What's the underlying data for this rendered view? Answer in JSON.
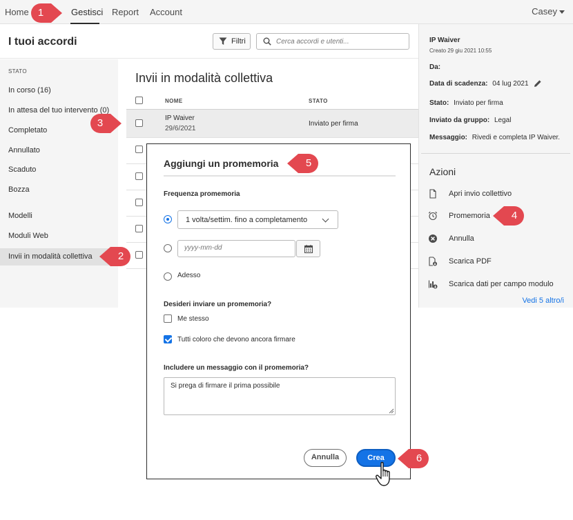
{
  "nav": {
    "tabs": [
      "Home",
      "Gestisci",
      "Report",
      "Account"
    ],
    "active_tab": "Gestisci",
    "user": "Casey"
  },
  "header": {
    "title": "I tuoi accordi",
    "filter_label": "Filtri",
    "search_placeholder": "Cerca accordi e utenti..."
  },
  "sidebar": {
    "section_label": "STATO",
    "items": [
      "In corso (16)",
      "In attesa del tuo intervento (0)",
      "Completato",
      "Annullato",
      "Scaduto",
      "Bozza",
      "Modelli",
      "Moduli Web",
      "Invii in modalità collettiva"
    ],
    "active_item": "Invii in modalità collettiva"
  },
  "main": {
    "title": "Invii in modalità collettiva",
    "columns": [
      "NOME",
      "STATO"
    ],
    "rows": [
      {
        "name": "IP Waiver",
        "date": "29/6/2021",
        "status": "Inviato per firma"
      }
    ]
  },
  "details": {
    "name": "IP Waiver",
    "created": "Creato 29 giu 2021 10:55",
    "from_label": "Da:",
    "due_label": "Data di scadenza:",
    "due_value": "04 lug 2021",
    "status_label": "Stato:",
    "status_value": "Inviato per firma",
    "group_label": "Inviato da gruppo:",
    "group_value": "Legal",
    "message_label": "Messaggio:",
    "message_value": "Rivedi e completa IP Waiver.",
    "actions_title": "Azioni",
    "actions": [
      "Apri invio collettivo",
      "Promemoria",
      "Annulla",
      "Scarica PDF",
      "Scarica dati per campo modulo"
    ],
    "see_more": "Vedi 5 altro/i"
  },
  "modal": {
    "title": "Aggiungi un promemoria",
    "frequency_label": "Frequenza promemoria",
    "frequency_selected": "1 volta/settim. fino a completamento",
    "date_placeholder": "yyyy-mm-dd",
    "now_label": "Adesso",
    "send_label": "Desideri inviare un promemoria?",
    "recipient_me": "Me stesso",
    "recipient_all": "Tutti coloro che devono ancora firmare",
    "message_label": "Includere un messaggio con il promemoria?",
    "message_value": "Si prega di firmare il prima possibile",
    "cancel_label": "Annulla",
    "create_label": "Crea"
  },
  "callouts": [
    "1",
    "2",
    "3",
    "4",
    "5",
    "6"
  ],
  "colors": {
    "accent": "#1473e6",
    "callout": "#e34850",
    "panel_bg": "#f5f5f5"
  }
}
